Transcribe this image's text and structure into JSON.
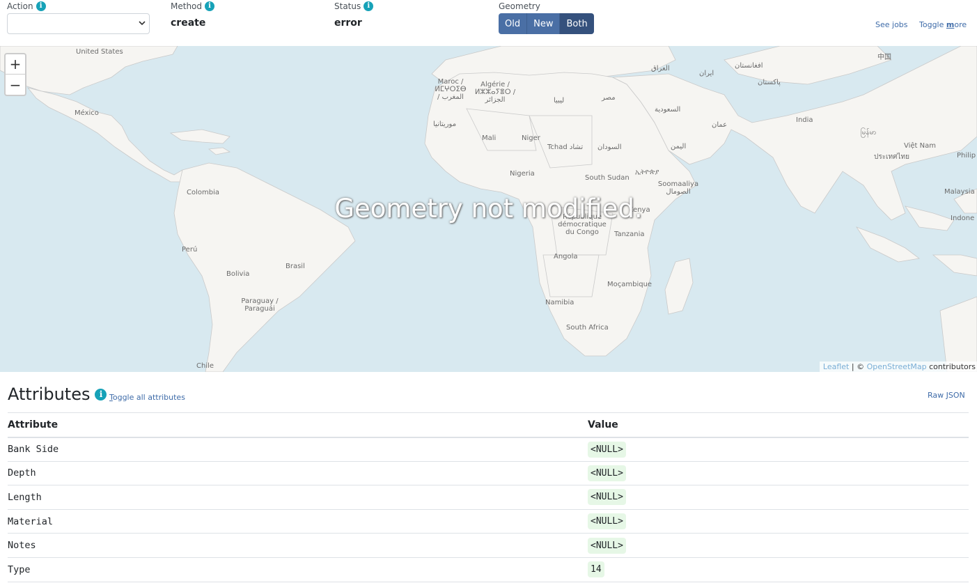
{
  "header": {
    "action_label": "Action",
    "method_label": "Method",
    "method_value": "create",
    "status_label": "Status",
    "status_value": "error",
    "geometry_label": "Geometry",
    "geometry_buttons": [
      "Old",
      "New",
      "Both"
    ],
    "geometry_selected": "Both",
    "see_jobs": "See jobs",
    "toggle_more_pre": "Toggle ",
    "toggle_more_key": "m",
    "toggle_more_post": "ore"
  },
  "map": {
    "zoom_in": "+",
    "zoom_out": "−",
    "overlay_text": "Geometry not modified.",
    "attribution_leaflet": "Leaflet",
    "attribution_sep": " | © ",
    "attribution_osm": "OpenStreetMap",
    "attribution_post": " contributors",
    "labels": [
      "United States",
      "México",
      "Colombia",
      "Perú",
      "Bolivia",
      "Brasil",
      "Paraguay / Paraguái",
      "Chile",
      "Maroc / ⵍⵎⵖⵔⵉⴱ / المغرب",
      "Algérie / ⵍⵣⵣⴰⵢⴻⵔ / الجزائر",
      "ليبيا",
      "مصر",
      "موريتانيا",
      "Mali",
      "Niger",
      "Tchad تشاد",
      "السودان",
      "Nigeria",
      "South Sudan",
      "ኢትዮጵያ",
      "Soomaaliya الصومال",
      "Kenya",
      "République démocratique du Congo",
      "Tanzania",
      "Angola",
      "Moçambique",
      "Namibia",
      "South Africa",
      "العراق",
      "ایران",
      "السعودية",
      "عمان",
      "اليمن",
      "افغانستان",
      "پاکستان",
      "India",
      "中国",
      "မြန်မာ",
      "ประเทศไทย",
      "Việt Nam",
      "Philip",
      "Malaysia",
      "Indone"
    ]
  },
  "attributes": {
    "title": "Attributes",
    "toggle_all_key": "T",
    "toggle_all_rest": "oggle all attributes",
    "raw_json": "Raw JSON",
    "columns": [
      "Attribute",
      "Value"
    ],
    "rows": [
      {
        "name": "Bank Side",
        "value": "<NULL>"
      },
      {
        "name": "Depth",
        "value": "<NULL>"
      },
      {
        "name": "Length",
        "value": "<NULL>"
      },
      {
        "name": "Material",
        "value": "<NULL>"
      },
      {
        "name": "Notes",
        "value": "<NULL>"
      },
      {
        "name": "Type",
        "value": "14"
      }
    ]
  },
  "colors": {
    "accent": "#17a2b8",
    "button": "#4a6fa5",
    "button_active": "#35517d",
    "link": "#3e6ba8",
    "water": "#d8e9f0",
    "land": "#f6f5f2",
    "value_bg": "#e6f7e6"
  }
}
